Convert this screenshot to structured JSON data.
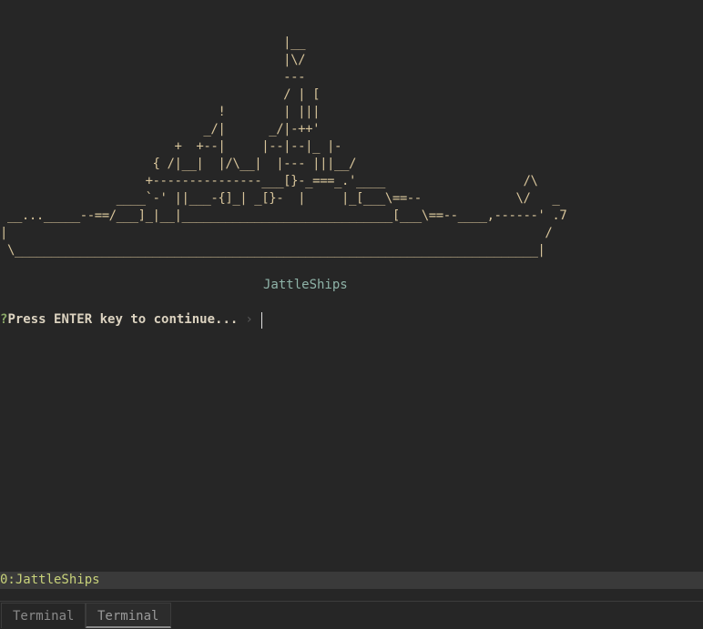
{
  "terminal": {
    "ship_art": "                                       |__\n                                       |\\/\n                                       ---\n                                       / | [\n                              !        | |||\n                            _/|      _/|-++'\n                        +  +--|     |--|--|_ |-\n                     { /|__|  |/\\__|  |--- |||__/\n                    +---------------___[}-_===_.'____                   /\\\n                ____`-' ||___-{]_| _[}-  |     |_[___\\==--             \\/   _\n __..._____--==/___]_|__|_____________________________[___\\==--____,------' .7\n|                                                                          /\n \\________________________________________________________________________|",
    "game_title": "JattleShips",
    "prompt_mark": "?",
    "prompt_text": "Press ENTER key to continue...",
    "prompt_arrow": "›"
  },
  "status_bar": {
    "window_label": "0:JattleShips"
  },
  "tabs": [
    {
      "label": "Terminal"
    },
    {
      "label": "Terminal"
    }
  ],
  "colors": {
    "background": "#262626",
    "art": "#d7c49a",
    "title": "#8fb3a8",
    "prompt_mark": "#8aa867",
    "status_text": "#c8d27a"
  }
}
